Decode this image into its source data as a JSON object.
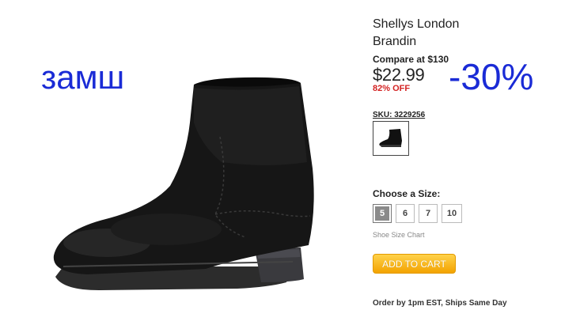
{
  "overlay": {
    "material_label": "замш",
    "discount_label": "-30%",
    "color": "#1a2bd6"
  },
  "product": {
    "image_icon": "black-suede-ankle-boot",
    "title_line1": "Shellys London",
    "title_line2": "Brandin",
    "compare_price": "Compare at $130",
    "price": "$22.99",
    "percent_off": "82% OFF",
    "sku": "SKU: 3229256"
  },
  "sizes": {
    "heading": "Choose a Size:",
    "options": [
      "5",
      "6",
      "7",
      "10"
    ],
    "selected": "5",
    "chart_link": "Shoe Size Chart"
  },
  "cart": {
    "button_label": "ADD TO CART",
    "button_color": "#f5a800"
  },
  "shipping": {
    "note": "Order by 1pm EST, Ships Same Day"
  }
}
